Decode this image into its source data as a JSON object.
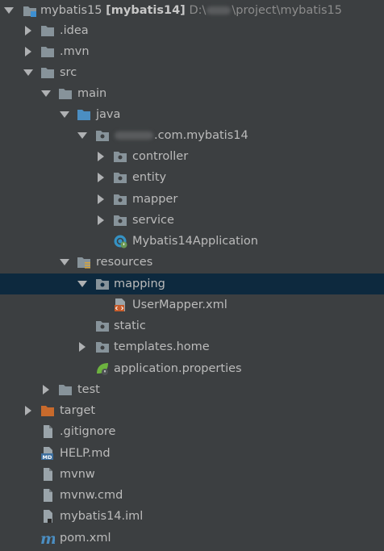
{
  "root": {
    "name": "mybatis15",
    "module": "[mybatis14]",
    "path_prefix": "D:\\",
    "path_suffix": "\\project\\mybatis15"
  },
  "items": {
    "idea": ".idea",
    "mvn": ".mvn",
    "src": "src",
    "main": "main",
    "java": "java",
    "package": ".com.mybatis14",
    "controller": "controller",
    "entity": "entity",
    "mapper": "mapper",
    "service": "service",
    "app": "Mybatis14Application",
    "resources": "resources",
    "mapping": "mapping",
    "usermapper": "UserMapper.xml",
    "static": "static",
    "templates": "templates.home",
    "appprops": "application.properties",
    "test": "test",
    "target": "target",
    "gitignore": ".gitignore",
    "help": "HELP.md",
    "mvnw": "mvnw",
    "mvnwcmd": "mvnw.cmd",
    "iml": "mybatis14.iml",
    "pom": "pom.xml"
  },
  "colors": {
    "background": "#3c3f41",
    "selection": "#0d293e",
    "folder": "#87939a",
    "source_folder": "#4b8ec2",
    "excluded_folder": "#c86a2c"
  }
}
